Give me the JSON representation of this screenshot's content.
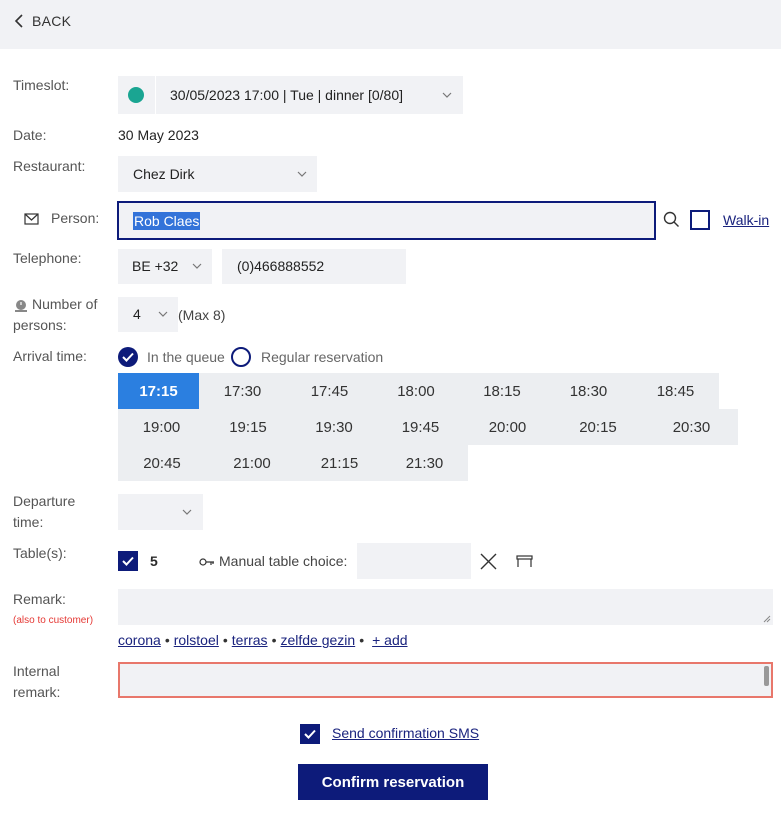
{
  "header": {
    "back_label": "BACK"
  },
  "form": {
    "timeslot": {
      "label": "Timeslot:",
      "value": "30/05/2023 17:00 | Tue | dinner [0/80]",
      "dot_color": "#1aa592"
    },
    "date": {
      "label": "Date:",
      "value": "30 May 2023"
    },
    "restaurant": {
      "label": "Restaurant:",
      "value": "Chez Dirk"
    },
    "person": {
      "label": "Person:",
      "value": "Rob Claes",
      "walkin_label": "Walk-in"
    },
    "telephone": {
      "label": "Telephone:",
      "country_code": "BE +32",
      "number": "(0)466888552"
    },
    "persons": {
      "label_line1": "Number of",
      "label_line2": "persons:",
      "value": "4",
      "max_note": "(Max 8)"
    },
    "arrival": {
      "label": "Arrival time:",
      "option_queue": "In the queue",
      "option_regular": "Regular reservation",
      "times": [
        "17:15",
        "17:30",
        "17:45",
        "18:00",
        "18:15",
        "18:30",
        "18:45",
        "19:00",
        "19:15",
        "19:30",
        "19:45",
        "20:00",
        "20:15",
        "20:30",
        "20:45",
        "21:00",
        "21:15",
        "21:30"
      ],
      "selected": "17:15"
    },
    "departure": {
      "label_line1": "Departure",
      "label_line2": "time:"
    },
    "tables": {
      "label": "Table(s):",
      "value": "5",
      "manual_label": "Manual table choice:"
    },
    "remark": {
      "label": "Remark:",
      "sublabel": "(also to customer)",
      "tags": [
        "corona",
        "rolstoel",
        "terras",
        "zelfde gezin"
      ],
      "add_label": "+ add"
    },
    "internal_remark": {
      "label_line1": "Internal",
      "label_line2": "remark:"
    },
    "sms": {
      "label": "Send confirmation SMS"
    },
    "confirm_label": "Confirm reservation"
  },
  "colors": {
    "accent": "#0d1b7a",
    "selected_time": "#2b7fe0",
    "field_bg": "#f1f2f5",
    "error_border": "#e8776b",
    "sublabel_red": "#e53935"
  }
}
